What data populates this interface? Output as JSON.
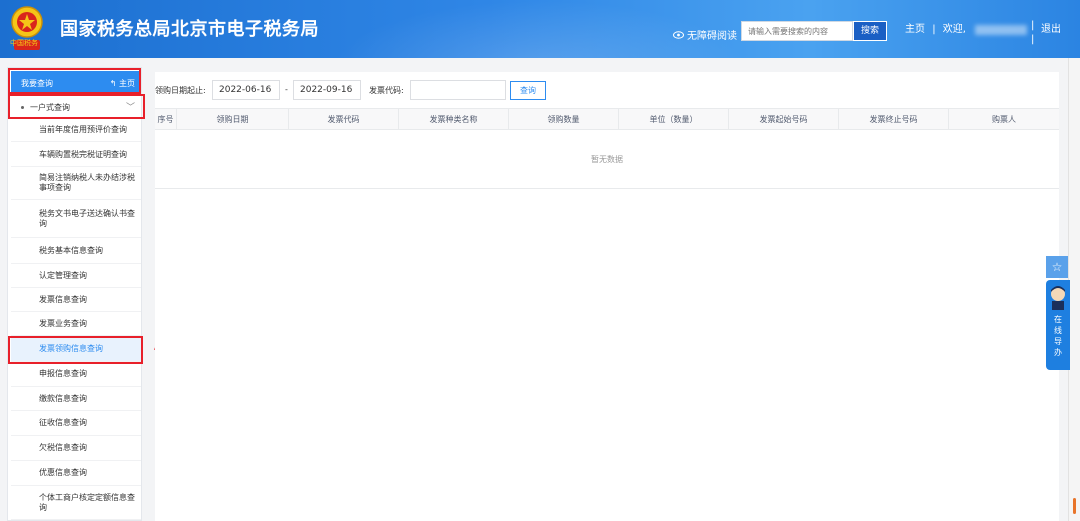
{
  "header": {
    "site_title": "国家税务总局北京市电子税务局",
    "emblem_text": "中国税务",
    "accessibility_label": "无障碍阅读",
    "search_placeholder": "请输入需要搜索的内容",
    "search_button": "搜索",
    "home_link": "主页",
    "separator": "|",
    "welcome": "欢迎,",
    "logout": "退出"
  },
  "sidebar": {
    "head_label": "我要查询",
    "head_home": "主页",
    "group_label": "一户式查询",
    "items": [
      {
        "label": "当前年度信用预评价查询"
      },
      {
        "label": "车辆购置税完税证明查询"
      },
      {
        "label": "简易注销纳税人未办结涉税事项查询"
      },
      {
        "label": "税务文书电子送达确认书查询"
      },
      {
        "label": "税务基本信息查询"
      },
      {
        "label": "认定管理查询"
      },
      {
        "label": "发票信息查询"
      },
      {
        "label": "发票业务查询"
      },
      {
        "label": "发票领购信息查询",
        "active": true
      },
      {
        "label": "申报信息查询"
      },
      {
        "label": "缴款信息查询"
      },
      {
        "label": "征收信息查询"
      },
      {
        "label": "欠税信息查询"
      },
      {
        "label": "优惠信息查询"
      },
      {
        "label": "个体工商户核定定额信息查询"
      }
    ]
  },
  "filter": {
    "date_label": "领购日期起止:",
    "date_start": "2022-06-16",
    "date_sep": "-",
    "date_end": "2022-09-16",
    "code_label": "发票代码:",
    "code_value": "",
    "query_button": "查询"
  },
  "table": {
    "columns": [
      "序号",
      "领购日期",
      "发票代码",
      "发票种类名称",
      "领购数量",
      "单位（数量）",
      "发票起始号码",
      "发票终止号码",
      "购票人"
    ],
    "empty_text": "暂无数据"
  },
  "service": {
    "text": "在线导办"
  },
  "colors": {
    "header_blue": "#2f86e6",
    "accent_blue": "#2d8cf0",
    "highlight_red": "#e8202a"
  }
}
